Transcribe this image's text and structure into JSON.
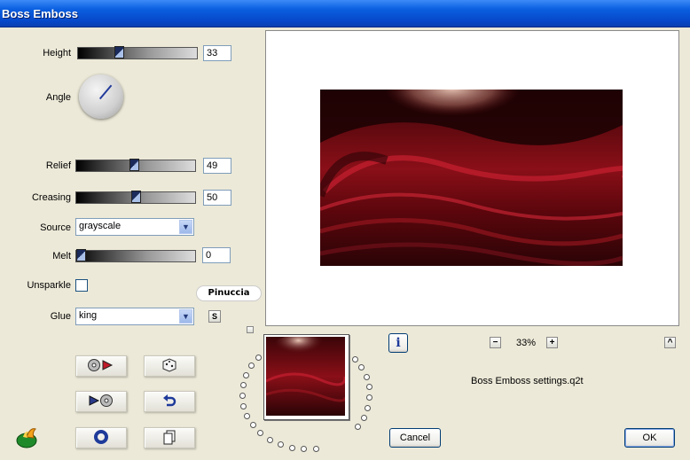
{
  "window": {
    "title": "Boss Emboss"
  },
  "controls": {
    "height": {
      "label": "Height",
      "value": "33",
      "level": 0.33
    },
    "angle": {
      "label": "Angle"
    },
    "relief": {
      "label": "Relief",
      "value": "49",
      "level": 0.49
    },
    "creasing": {
      "label": "Creasing",
      "value": "50",
      "level": 0.5
    },
    "source": {
      "label": "Source",
      "selected": "grayscale"
    },
    "melt": {
      "label": "Melt",
      "value": "0",
      "level": 0.0
    },
    "unsparkle": {
      "label": "Unsparkle",
      "checked": false
    },
    "glue": {
      "label": "Glue",
      "selected": "king",
      "s_button": "S"
    }
  },
  "watermark": {
    "text": "Pinuccia"
  },
  "zoom": {
    "minus": "−",
    "value": "33%",
    "plus": "+"
  },
  "info_button": "i",
  "scroll_up": "^",
  "settings_file": "Boss Emboss settings.q2t",
  "buttons": {
    "cancel": "Cancel",
    "ok": "OK"
  },
  "colors": {
    "titlebar": "#0a5fe0",
    "accent_dark_red": "#7a0a12"
  }
}
